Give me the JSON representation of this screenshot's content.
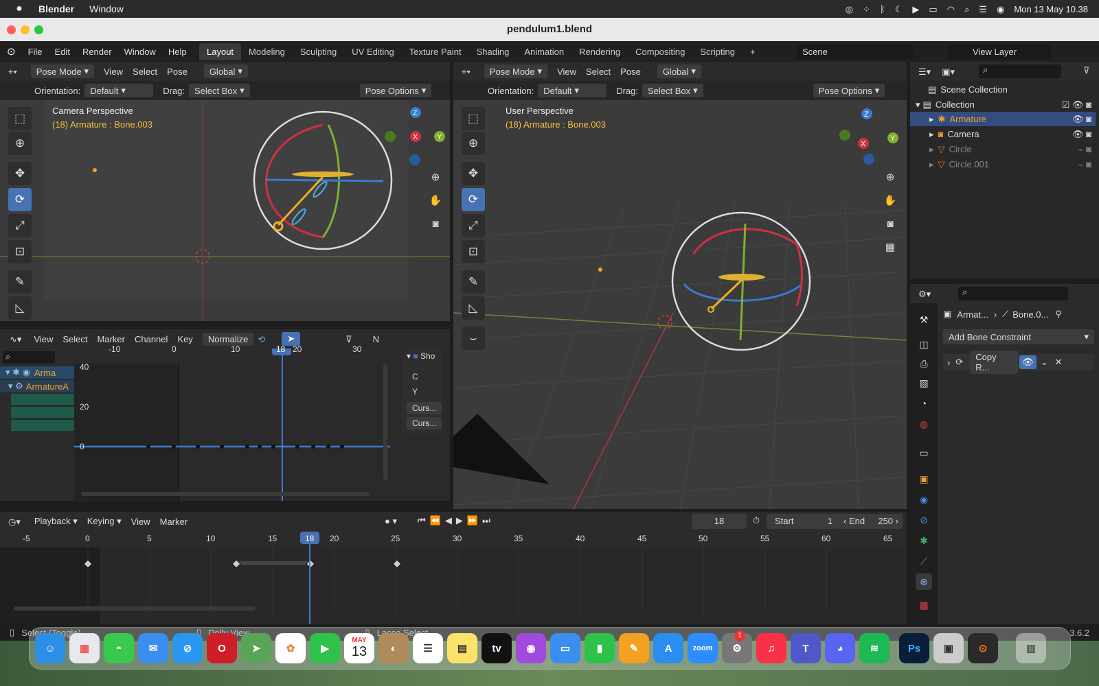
{
  "macos": {
    "app_name": "Blender",
    "menu": [
      "Window"
    ],
    "datetime": "Mon 13 May  10.38"
  },
  "window": {
    "title": "pendulum1.blend"
  },
  "blender_menu": [
    "File",
    "Edit",
    "Render",
    "Window",
    "Help"
  ],
  "workspaces": [
    "Layout",
    "Modeling",
    "Sculpting",
    "UV Editing",
    "Texture Paint",
    "Shading",
    "Animation",
    "Rendering",
    "Compositing",
    "Scripting"
  ],
  "active_workspace": "Layout",
  "scene": {
    "name": "Scene",
    "view_layer": "View Layer"
  },
  "viewport_left": {
    "mode": "Pose Mode",
    "menus": [
      "View",
      "Select",
      "Pose"
    ],
    "transform": "Global",
    "orientation_label": "Orientation:",
    "orientation": "Default",
    "drag_label": "Drag:",
    "drag": "Select Box",
    "pose_options": "Pose Options",
    "title": "Camera Perspective",
    "subtitle": "(18) Armature : Bone.003"
  },
  "viewport_right": {
    "mode": "Pose Mode",
    "menus": [
      "View",
      "Select",
      "Pose"
    ],
    "transform": "Global",
    "orientation_label": "Orientation:",
    "orientation": "Default",
    "drag_label": "Drag:",
    "drag": "Select Box",
    "pose_options": "Pose Options",
    "title": "User Perspective",
    "subtitle": "(18) Armature : Bone.003"
  },
  "graph_editor": {
    "menus": [
      "View",
      "Select",
      "Marker",
      "Channel",
      "Key"
    ],
    "normalize": "Normalize",
    "x_ticks": [
      "-10",
      "0",
      "10",
      "20",
      "30"
    ],
    "y_ticks": [
      "40",
      "20",
      "0"
    ],
    "current_frame": "18",
    "channels": [
      "Arma",
      "ArmatureA"
    ],
    "side_panel": {
      "show": "Sho",
      "c": "C",
      "y": "Y",
      "cursor1": "Curs...",
      "cursor2": "Curs..."
    },
    "n_label": "N"
  },
  "outliner": {
    "scene_collection": "Scene Collection",
    "collection": "Collection",
    "items": [
      "Armature",
      "Camera",
      "Circle",
      "Circle.001"
    ]
  },
  "properties": {
    "breadcrumb_obj": "Armat...",
    "breadcrumb_bone": "Bone.0...",
    "add_constraint": "Add Bone Constraint",
    "constraint_name": "Copy R..."
  },
  "timeline": {
    "menus": [
      "Playback",
      "Keying",
      "View",
      "Marker"
    ],
    "frame": "18",
    "start_label": "Start",
    "start": "1",
    "end_label": "End",
    "end": "250",
    "ticks": [
      "-5",
      "0",
      "5",
      "10",
      "15",
      "20",
      "25",
      "30",
      "35",
      "40",
      "45",
      "50",
      "55",
      "60",
      "65"
    ],
    "current": "18"
  },
  "statusbar": {
    "select": "Select (Toggle)",
    "dolly": "Dolly View",
    "lasso": "Lasso Select",
    "version": "3.6.2"
  },
  "dock": {
    "calendar_month": "MAY",
    "calendar_day": "13",
    "zoom": "zoom",
    "ps": "Ps",
    "badge": "1"
  },
  "colors": {
    "accent": "#4772b3",
    "selected_text": "#f0a030",
    "header": "#2b2b2b",
    "viewport": "#3b3b3b"
  }
}
